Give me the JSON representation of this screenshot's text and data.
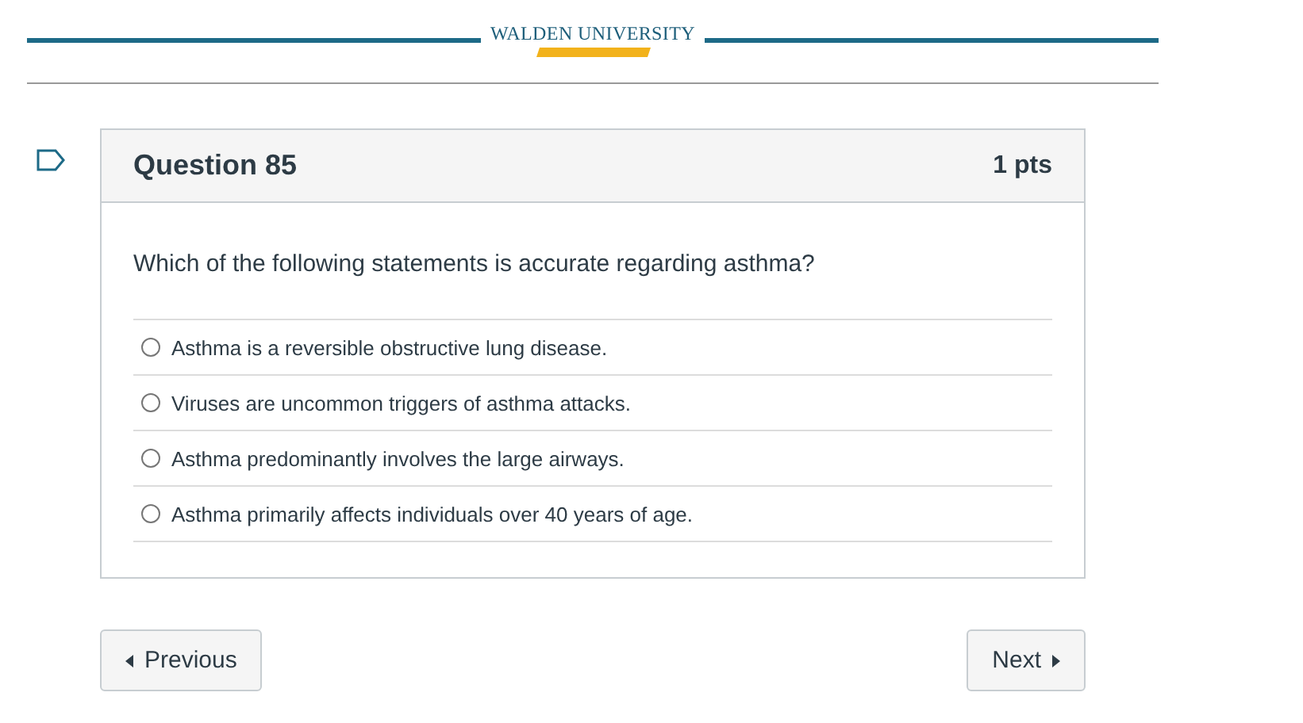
{
  "header": {
    "logo_text": "WALDEN UNIVERSITY"
  },
  "question": {
    "title": "Question 85",
    "points": "1 pts",
    "flagged": false,
    "text": "Which of the following statements is accurate regarding asthma?",
    "answers": [
      {
        "label": "Asthma is a reversible obstructive lung disease.",
        "selected": false
      },
      {
        "label": "Viruses are uncommon triggers of asthma attacks.",
        "selected": false
      },
      {
        "label": "Asthma predominantly involves the large airways.",
        "selected": false
      },
      {
        "label": "Asthma primarily affects individuals over 40 years of age.",
        "selected": false
      }
    ]
  },
  "nav": {
    "previous": "Previous",
    "next": "Next"
  }
}
